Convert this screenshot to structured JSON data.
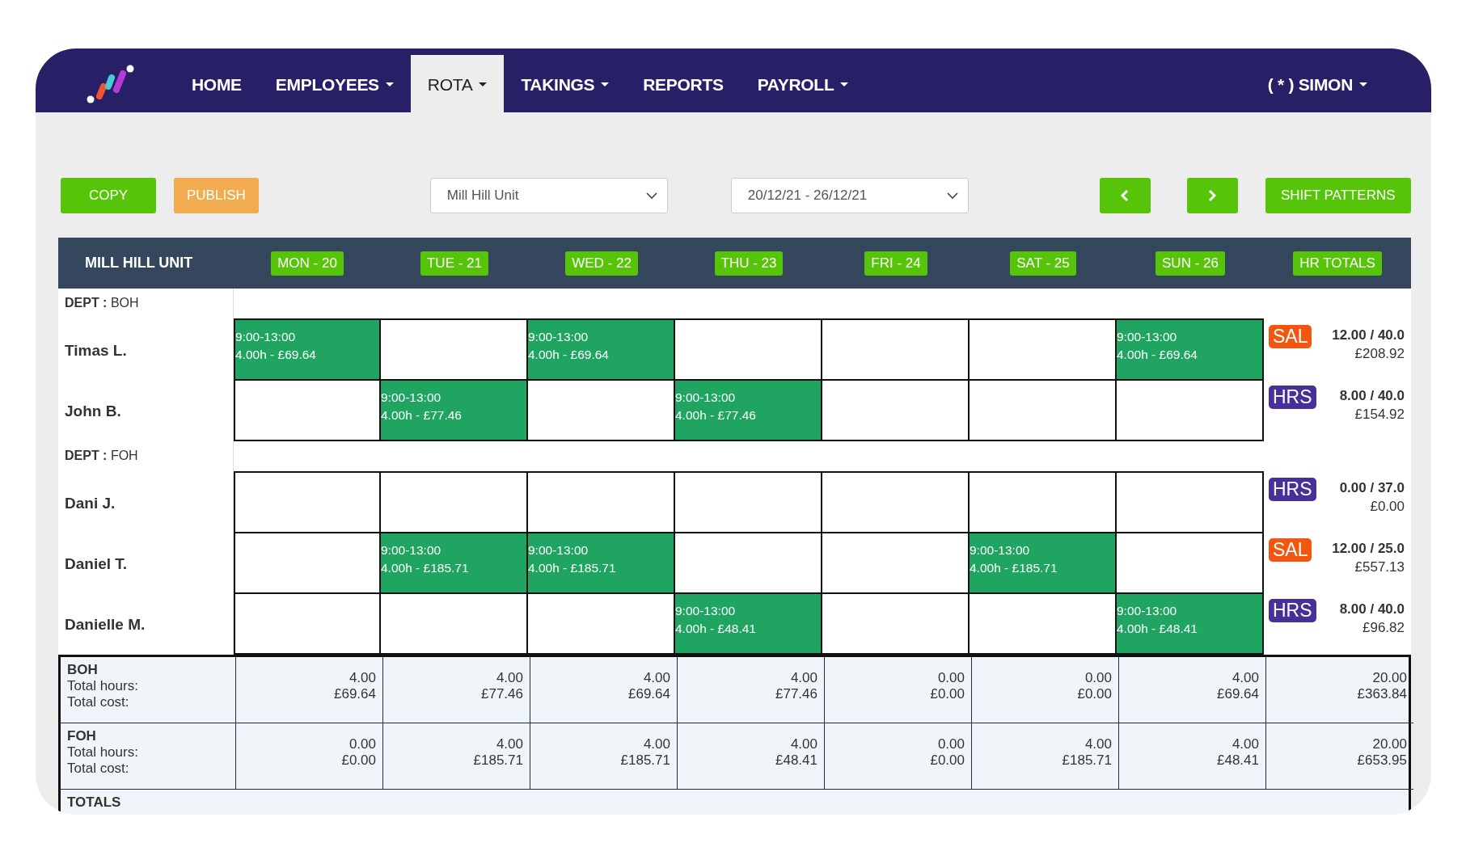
{
  "nav": {
    "items": [
      {
        "label": "HOME",
        "dropdown": false,
        "selected": false
      },
      {
        "label": "EMPLOYEES",
        "dropdown": true,
        "selected": false
      },
      {
        "label": "ROTA",
        "dropdown": true,
        "selected": true
      },
      {
        "label": "TAKINGS",
        "dropdown": true,
        "selected": false
      },
      {
        "label": "REPORTS",
        "dropdown": false,
        "selected": false
      },
      {
        "label": "PAYROLL",
        "dropdown": true,
        "selected": false
      }
    ],
    "user": {
      "label": "( * ) SIMON",
      "dropdown": true
    }
  },
  "toolbar": {
    "buttons": [
      {
        "kind": "copy",
        "label": "COPY"
      },
      {
        "kind": "publish",
        "label": "PUBLISH"
      }
    ],
    "unit_select": {
      "value": "Mill Hill Unit"
    },
    "week_select": {
      "value": "20/12/21 - 26/12/21"
    },
    "shift_patterns_button": "SHIFT PATTERNS"
  },
  "rota": {
    "unit": "MILL HILL UNIT",
    "days": [
      "MON - 20",
      "TUE - 21",
      "WED - 22",
      "THU - 23",
      "FRI - 24",
      "SAT - 25",
      "SUN - 26"
    ],
    "totals_heading": "HR TOTALS",
    "departments": [
      {
        "label": "**DEPT :** BOH",
        "employees": [
          {
            "name": "Timas L.",
            "shifts": [
              {
                "filled": true,
                "time": "9:00-13:00",
                "detail": "4.00h - £69.64"
              },
              {
                "filled": false
              },
              {
                "filled": true,
                "time": "9:00-13:00",
                "detail": "4.00h - £69.64"
              },
              {
                "filled": false
              },
              {
                "filled": false
              },
              {
                "filled": false
              },
              {
                "filled": true,
                "time": "9:00-13:00",
                "detail": "4.00h - £69.64"
              }
            ],
            "pay_type": {
              "kind": "salaried",
              "label": "SAL"
            },
            "hours": "12.00 / 40.0",
            "cost": "£208.92"
          },
          {
            "name": "John B.",
            "shifts": [
              {
                "filled": false
              },
              {
                "filled": true,
                "time": "9:00-13:00",
                "detail": "4.00h - £77.46"
              },
              {
                "filled": false
              },
              {
                "filled": true,
                "time": "9:00-13:00",
                "detail": "4.00h - £77.46"
              },
              {
                "filled": false
              },
              {
                "filled": false
              },
              {
                "filled": false
              }
            ],
            "pay_type": {
              "kind": "hourly",
              "label": "HRS"
            },
            "hours": "8.00 / 40.0",
            "cost": "£154.92"
          }
        ]
      },
      {
        "label": "**DEPT :** FOH",
        "employees": [
          {
            "name": "Dani J.",
            "shifts": [
              {
                "filled": false
              },
              {
                "filled": false
              },
              {
                "filled": false
              },
              {
                "filled": false
              },
              {
                "filled": false
              },
              {
                "filled": false
              },
              {
                "filled": false
              }
            ],
            "pay_type": {
              "kind": "hourly",
              "label": "HRS"
            },
            "hours": "0.00 / 37.0",
            "cost": "£0.00"
          },
          {
            "name": "Daniel T.",
            "shifts": [
              {
                "filled": false
              },
              {
                "filled": true,
                "time": "9:00-13:00",
                "detail": "4.00h - £185.71"
              },
              {
                "filled": true,
                "time": "9:00-13:00",
                "detail": "4.00h - £185.71"
              },
              {
                "filled": false
              },
              {
                "filled": false
              },
              {
                "filled": true,
                "time": "9:00-13:00",
                "detail": "4.00h - £185.71"
              },
              {
                "filled": false
              }
            ],
            "pay_type": {
              "kind": "salaried",
              "label": "SAL"
            },
            "hours": "12.00 / 25.0",
            "cost": "£557.13"
          },
          {
            "name": "Danielle M.",
            "shifts": [
              {
                "filled": false
              },
              {
                "filled": false
              },
              {
                "filled": false
              },
              {
                "filled": true,
                "time": "9:00-13:00",
                "detail": "4.00h - £48.41"
              },
              {
                "filled": false
              },
              {
                "filled": false
              },
              {
                "filled": true,
                "time": "9:00-13:00",
                "detail": "4.00h - £48.41"
              }
            ],
            "pay_type": {
              "kind": "hourly",
              "label": "HRS"
            },
            "hours": "8.00 / 40.0",
            "cost": "£96.82"
          }
        ]
      }
    ],
    "summary": [
      {
        "dept": "BOH",
        "hours_label": "Total hours:",
        "cost_label": "Total cost:",
        "days": [
          {
            "hours": "4.00",
            "cost": "£69.64"
          },
          {
            "hours": "4.00",
            "cost": "£77.46"
          },
          {
            "hours": "4.00",
            "cost": "£69.64"
          },
          {
            "hours": "4.00",
            "cost": "£77.46"
          },
          {
            "hours": "0.00",
            "cost": "£0.00"
          },
          {
            "hours": "0.00",
            "cost": "£0.00"
          },
          {
            "hours": "4.00",
            "cost": "£69.64"
          }
        ],
        "total": {
          "hours": "20.00",
          "cost": "£363.84"
        }
      },
      {
        "dept": "FOH",
        "hours_label": "Total hours:",
        "cost_label": "Total cost:",
        "days": [
          {
            "hours": "0.00",
            "cost": "£0.00"
          },
          {
            "hours": "4.00",
            "cost": "£185.71"
          },
          {
            "hours": "4.00",
            "cost": "£185.71"
          },
          {
            "hours": "4.00",
            "cost": "£48.41"
          },
          {
            "hours": "0.00",
            "cost": "£0.00"
          },
          {
            "hours": "4.00",
            "cost": "£185.71"
          },
          {
            "hours": "4.00",
            "cost": "£48.41"
          }
        ],
        "total": {
          "hours": "20.00",
          "cost": "£653.95"
        }
      }
    ],
    "totals_label": "TOTALS"
  }
}
